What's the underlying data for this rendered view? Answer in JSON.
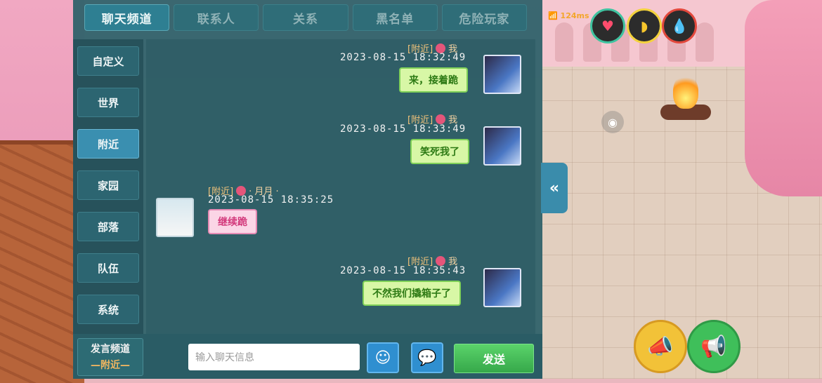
{
  "tabs": [
    "聊天频道",
    "联系人",
    "关系",
    "黑名单",
    "危险玩家"
  ],
  "active_tab_index": 0,
  "sidebar": [
    "自定义",
    "世界",
    "附近",
    "家园",
    "部落",
    "队伍",
    "系统"
  ],
  "active_sidebar_index": 2,
  "messages": [
    {
      "channel": "[附近]",
      "name": "我",
      "time": "2023-08-15  18:32:49",
      "text": "来，接着跪",
      "self": true
    },
    {
      "channel": "[附近]",
      "name": "我",
      "time": "2023-08-15  18:33:49",
      "text": "笑死我了",
      "self": true
    },
    {
      "channel": "[附近]",
      "name": "· 月月 ·",
      "time": "2023-08-15  18:35:25",
      "text": "继续跪",
      "self": false
    },
    {
      "channel": "[附近]",
      "name": "我",
      "time": "2023-08-15  18:35:43",
      "text": "不然我们撬箱子了",
      "self": true
    }
  ],
  "speak_channel": {
    "title": "发言频道",
    "value": "—附近—"
  },
  "input": {
    "placeholder": "输入聊天信息",
    "value": ""
  },
  "send_label": "发送",
  "signal_text": "124ms",
  "colors": {
    "panel": "#2c6068",
    "self_bubble": "#d8f7a6",
    "other_bubble": "#fbd5e6",
    "send": "#3fb34f",
    "accent": "#3a8fb0"
  },
  "icons": [
    "emoji-icon",
    "chat-bubble-icon",
    "heart-icon",
    "hunger-icon",
    "water-icon",
    "eye-icon",
    "collapse-arrow-icon",
    "megaphone-icon",
    "speaker-icon"
  ]
}
